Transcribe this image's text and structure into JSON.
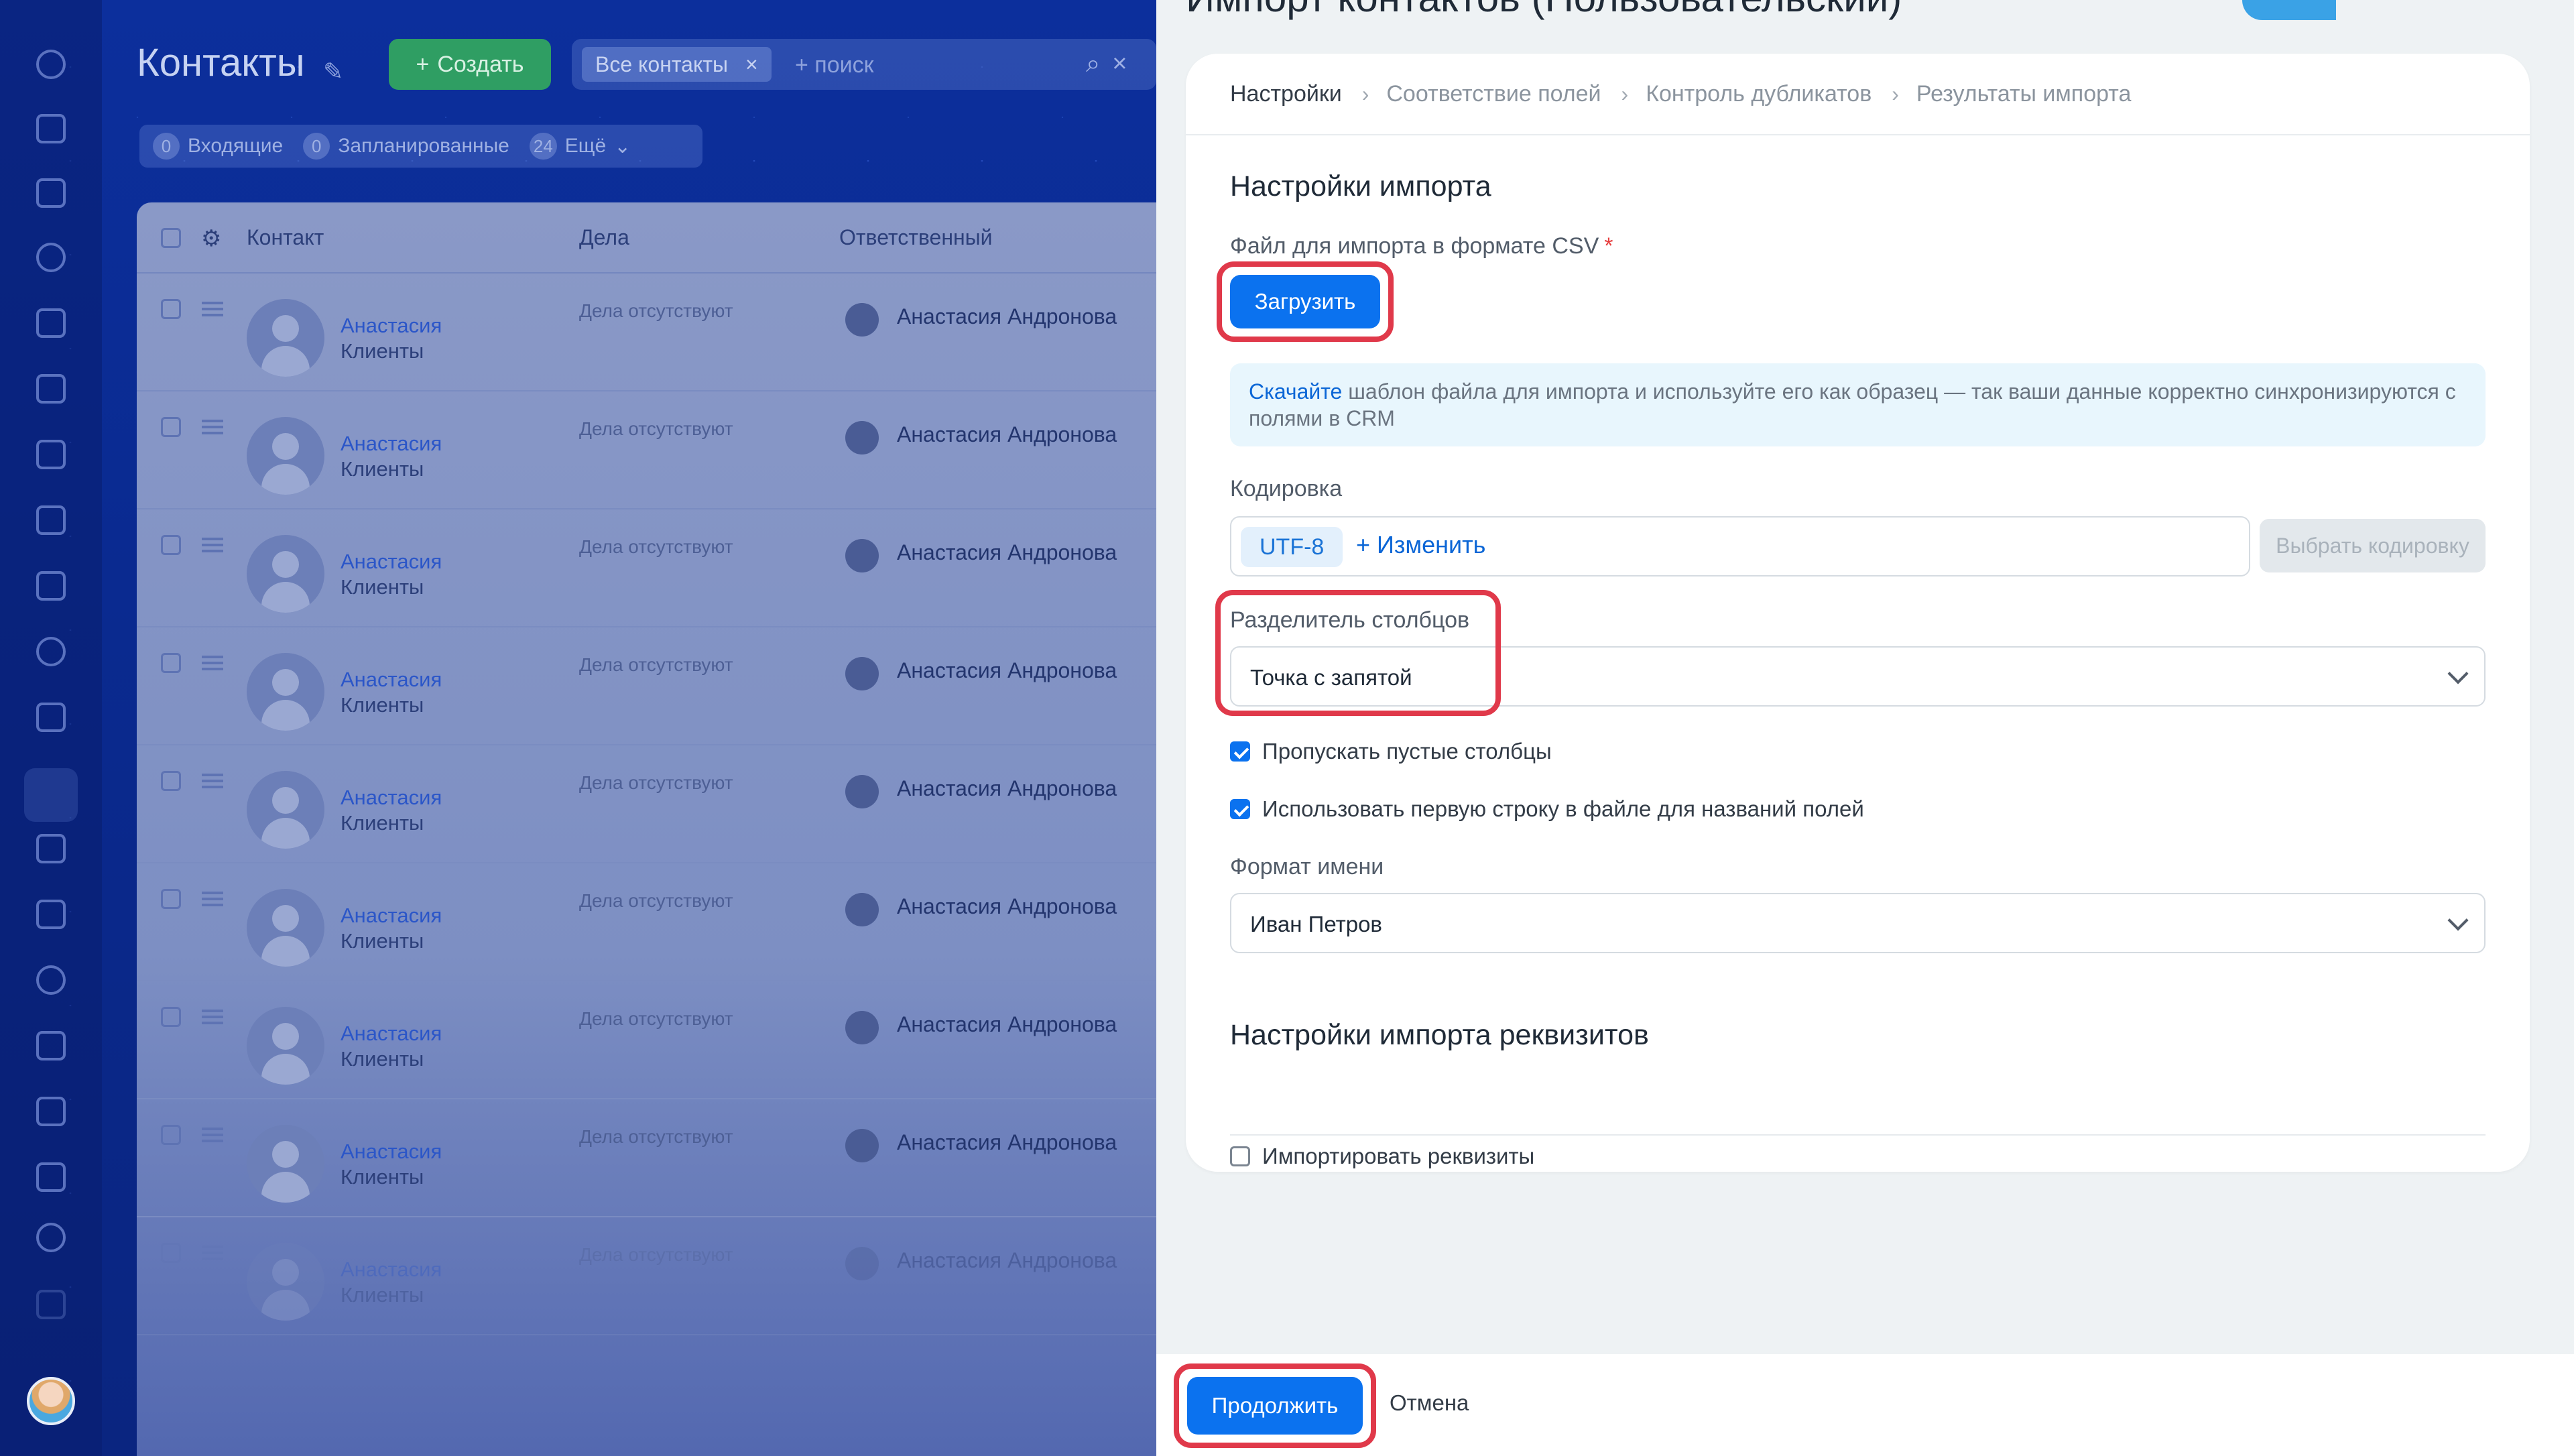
{
  "background_app": {
    "title": "Контакты",
    "create_label": "Создать",
    "filter_chip": "Все контакты",
    "search_placeholder": "+ поиск",
    "counters": [
      {
        "count": "0",
        "label": "Входящие"
      },
      {
        "count": "0",
        "label": "Запланированные"
      },
      {
        "count": "24",
        "label": "Ещё"
      }
    ],
    "columns": [
      "Контакт",
      "Дела",
      "Ответственный"
    ],
    "rows": [
      {
        "name": "Анастасия",
        "type": "Клиенты",
        "deals": "Дела отсутствуют",
        "responsible": "Анастасия Андронова"
      },
      {
        "name": "Анастасия",
        "type": "Клиенты",
        "deals": "Дела отсутствуют",
        "responsible": "Анастасия Андронова"
      },
      {
        "name": "Анастасия",
        "type": "Клиенты",
        "deals": "Дела отсутствуют",
        "responsible": "Анастасия Андронова"
      },
      {
        "name": "Анастасия",
        "type": "Клиенты",
        "deals": "Дела отсутствуют",
        "responsible": "Анастасия Андронова"
      },
      {
        "name": "Анастасия",
        "type": "Клиенты",
        "deals": "Дела отсутствуют",
        "responsible": "Анастасия Андронова"
      },
      {
        "name": "Анастасия",
        "type": "Клиенты",
        "deals": "Дела отсутствуют",
        "responsible": "Анастасия Андронова"
      },
      {
        "name": "Анастасия",
        "type": "Клиенты",
        "deals": "Дела отсутствуют",
        "responsible": "Анастасия Андронова"
      },
      {
        "name": "Анастасия",
        "type": "Клиенты",
        "deals": "Дела отсутствуют",
        "responsible": "Анастасия Андронова"
      },
      {
        "name": "Анастасия",
        "type": "Клиенты",
        "deals": "Дела отсутствуют",
        "responsible": "Анастасия Андронова"
      }
    ]
  },
  "panel": {
    "title": "Импорт контактов (Пользовательский)",
    "steps": [
      "Настройки",
      "Соответствие полей",
      "Контроль дубликатов",
      "Результаты импорта"
    ],
    "import_settings_title": "Настройки импорта",
    "file_label": "Файл для импорта в формате CSV",
    "required_mark": "*",
    "upload_label": "Загрузить",
    "info_link": "Скачайте",
    "info_text": " шаблон файла для импорта и используйте его как образец — так ваши данные корректно синхронизируются с полями в CRM",
    "encoding_label": "Кодировка",
    "encoding_value": "UTF-8",
    "encoding_change": "+ Изменить",
    "choose_encoding_label": "Выбрать кодировку",
    "separator_label": "Разделитель столбцов",
    "separator_value": "Точка с запятой",
    "skip_empty_label": "Пропускать пустые столбцы",
    "skip_empty_checked": true,
    "first_row_label": "Использовать первую строку в файле для названий полей",
    "first_row_checked": true,
    "name_format_label": "Формат имени",
    "name_format_value": "Иван Петров",
    "requisites_title": "Настройки импорта реквизитов",
    "import_requisites_label": "Импортировать реквизиты",
    "import_requisites_checked": false,
    "continue_label": "Продолжить",
    "cancel_label": "Отмена"
  },
  "colors": {
    "primary": "#0b72ef",
    "highlight": "#e0394a",
    "create_button": "#2f9e63"
  }
}
